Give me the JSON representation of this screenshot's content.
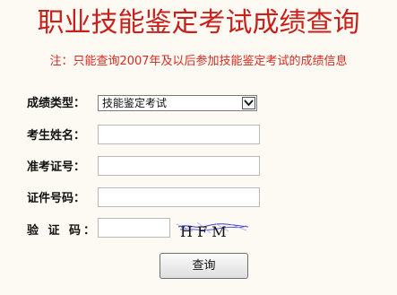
{
  "page": {
    "title": "职业技能鉴定考试成绩查询",
    "note": "注：只能查询2007年及以后参加技能鉴定考试的成绩信息"
  },
  "form": {
    "score_type": {
      "label": "成绩类型：",
      "value": "技能鉴定考试"
    },
    "name": {
      "label": "考生姓名：",
      "value": ""
    },
    "admission_number": {
      "label": "准考证号：",
      "value": ""
    },
    "id_number": {
      "label": "证件号码：",
      "value": ""
    },
    "captcha": {
      "label": "验 证 码：",
      "value": "",
      "image_text": "H F M"
    },
    "query_button": "查询"
  }
}
